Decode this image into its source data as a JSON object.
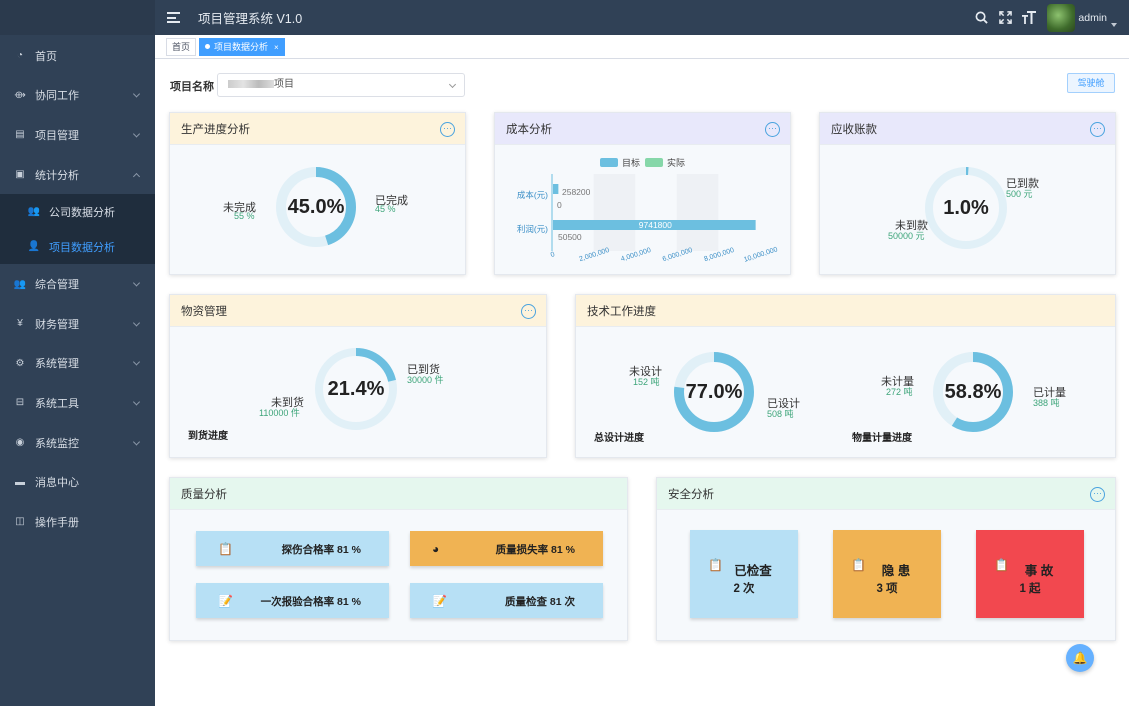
{
  "header": {
    "title": "项目管理系统 V1.0",
    "user": "admin"
  },
  "sidebar": {
    "items": [
      {
        "label": "首页",
        "icon": "dashboard-icon"
      },
      {
        "label": "协同工作",
        "icon": "cooperation-icon"
      },
      {
        "label": "项目管理",
        "icon": "project-icon"
      },
      {
        "label": "统计分析",
        "icon": "statistics-icon"
      },
      {
        "label": "公司数据分析",
        "icon": "users-icon"
      },
      {
        "label": "项目数据分析",
        "icon": "user-icon"
      },
      {
        "label": "综合管理",
        "icon": "users-icon"
      },
      {
        "label": "财务管理",
        "icon": "yen-icon"
      },
      {
        "label": "系统管理",
        "icon": "gear-icon"
      },
      {
        "label": "系统工具",
        "icon": "toolbox-icon"
      },
      {
        "label": "系统监控",
        "icon": "eye-icon"
      },
      {
        "label": "消息中心",
        "icon": "message-icon"
      },
      {
        "label": "操作手册",
        "icon": "book-icon"
      }
    ]
  },
  "tags": {
    "home": "首页",
    "current": "项目数据分析",
    "close": "×"
  },
  "filter": {
    "label": "项目名称",
    "value": "项目",
    "cockpit": "驾驶舱"
  },
  "production": {
    "title": "生产进度分析",
    "percent": 45.0,
    "percent_text": "45.0%",
    "left_label": "未完成",
    "left_value": "55 %",
    "right_label": "已完成",
    "right_value": "45 %"
  },
  "cost": {
    "title": "成本分析",
    "chart_data": {
      "type": "bar",
      "orientation": "horizontal",
      "categories": [
        "成本(元)",
        "利润(元)"
      ],
      "series": [
        {
          "name": "目标",
          "values": [
            258200,
            9741800
          ]
        },
        {
          "name": "实际",
          "values": [
            0,
            50500
          ]
        }
      ],
      "value_labels": [
        "258200",
        "0",
        "9741800",
        "50500"
      ],
      "xticks": [
        "0",
        "2,000,000",
        "4,000,000",
        "6,000,000",
        "8,000,000",
        "10,000,000"
      ],
      "xlim": [
        0,
        10000000
      ],
      "colors": {
        "目标": "#6cbfe0",
        "实际": "#86d7a9"
      },
      "legend": "top"
    }
  },
  "receivable": {
    "title": "应收账款",
    "percent": 1.0,
    "percent_text": "1.0%",
    "right_label": "已到款",
    "right_value": "500 元",
    "left_label": "未到款",
    "left_value": "50000 元"
  },
  "material": {
    "title": "物资管理",
    "percent": 21.4,
    "percent_text": "21.4%",
    "right_label": "已到货",
    "right_value": "30000 件",
    "left_label": "未到货",
    "left_value": "110000 件",
    "caption": "到货进度"
  },
  "tech": {
    "title": "技术工作进度",
    "design": {
      "percent": 77.0,
      "percent_text": "77.0%",
      "left_label": "未设计",
      "left_value": "152 吨",
      "right_label": "已设计",
      "right_value": "508 吨",
      "caption": "总设计进度"
    },
    "measure": {
      "percent": 58.8,
      "percent_text": "58.8%",
      "left_label": "未计量",
      "left_value": "272 吨",
      "right_label": "已计量",
      "right_value": "388 吨",
      "caption": "物量计量进度"
    }
  },
  "quality": {
    "title": "质量分析",
    "items": [
      {
        "label": "探伤合格率 81 %",
        "color": "#b7e0f5"
      },
      {
        "label": "质量损失率 81 %",
        "color": "#f0b353"
      },
      {
        "label": "一次报验合格率 81 %",
        "color": "#b7e0f5"
      },
      {
        "label": "质量检查 81 次",
        "color": "#b7e0f5"
      }
    ]
  },
  "safety": {
    "title": "安全分析",
    "items": [
      {
        "label": "已检查",
        "value": "2 次",
        "color": "#b7e0f5"
      },
      {
        "label": "隐 患",
        "value": "3 项",
        "color": "#f0b353"
      },
      {
        "label": "事 故",
        "value": "1 起",
        "color": "#f2484f"
      }
    ]
  },
  "colors": {
    "ring_fill": "#6cbfe0",
    "ring_track": "#e1f0f7",
    "accent": "#409eff"
  }
}
